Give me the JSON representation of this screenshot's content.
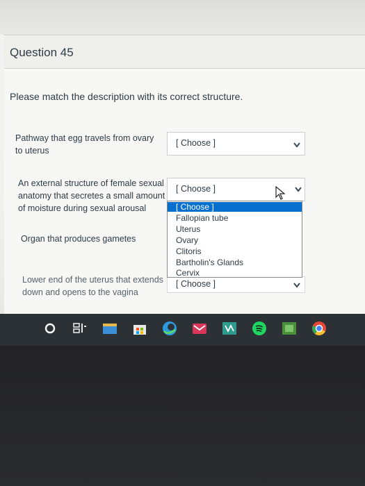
{
  "question": {
    "title": "Question 45",
    "prompt": "Please match the description with its correct structure."
  },
  "items": [
    {
      "description_lines": [
        "Pathway that egg travels from ovary",
        "to uterus"
      ],
      "selected": "[ Choose ]"
    },
    {
      "description_lines": [
        "An external structure of female sexual",
        "anatomy that secretes a small amount",
        "of moisture during sexual arousal"
      ],
      "selected": "[ Choose ]"
    },
    {
      "description_lines": [
        "Organ that produces gametes"
      ],
      "selected": "[ Choose ]"
    },
    {
      "description_lines": [
        "Lower end of the uterus that extends",
        "down and opens to the vagina"
      ],
      "selected": "[ Choose ]"
    }
  ],
  "dropdown": {
    "options": [
      "[ Choose ]",
      "Fallopian tube",
      "Uterus",
      "Ovary",
      "Clitoris",
      "Bartholin's Glands",
      "Cervix"
    ],
    "highlighted_index": 0,
    "highlight_color": "#0770cf"
  },
  "taskbar": {
    "icons": [
      "start-circle-icon",
      "task-view-icon",
      "file-explorer-icon",
      "store-icon",
      "edge-icon",
      "mail-icon",
      "onenote-icon",
      "spotify-icon",
      "photos-icon",
      "chrome-icon"
    ]
  }
}
